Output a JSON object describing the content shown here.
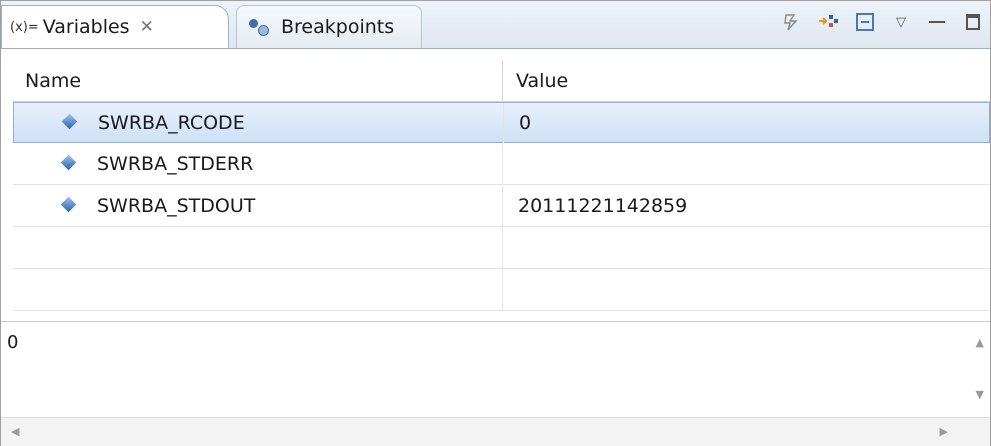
{
  "tabs": {
    "variables": {
      "icon_text": "(x)=",
      "label": "Variables",
      "close": "✕"
    },
    "breakpoints": {
      "label": "Breakpoints"
    }
  },
  "toolbar": {
    "icons": [
      "show-logical-structure-icon",
      "collapse-tree-icon",
      "collapse-all-icon",
      "view-menu-icon",
      "minimize-icon",
      "maximize-icon"
    ]
  },
  "table": {
    "headers": {
      "name": "Name",
      "value": "Value"
    },
    "rows": [
      {
        "name": "SWRBA_RCODE",
        "value": "0",
        "selected": true
      },
      {
        "name": "SWRBA_STDERR",
        "value": ""
      },
      {
        "name": "SWRBA_STDOUT",
        "value": "20111221142859"
      }
    ]
  },
  "detail": {
    "text": "0"
  },
  "colors": {
    "selection": "#cfe0f6",
    "accent": "#3f6fa8"
  }
}
